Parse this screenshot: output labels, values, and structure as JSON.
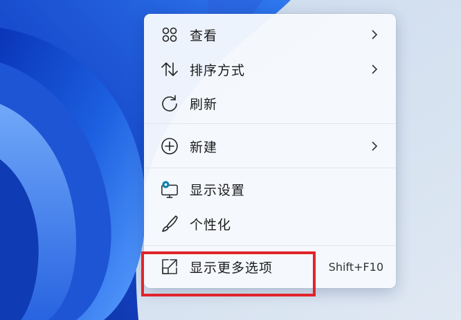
{
  "context_menu": {
    "items": [
      {
        "label": "查看",
        "icon": "grid-view-icon",
        "has_submenu": true
      },
      {
        "label": "排序方式",
        "icon": "sort-arrows-icon",
        "has_submenu": true
      },
      {
        "label": "刷新",
        "icon": "refresh-icon",
        "has_submenu": false
      },
      {
        "label": "新建",
        "icon": "plus-circle-icon",
        "has_submenu": true
      },
      {
        "label": "显示设置",
        "icon": "display-settings-icon",
        "has_submenu": false
      },
      {
        "label": "个性化",
        "icon": "brush-icon",
        "has_submenu": false
      },
      {
        "label": "显示更多选项",
        "icon": "open-external-icon",
        "has_submenu": false,
        "shortcut": "Shift+F10"
      }
    ]
  },
  "annotation": {
    "highlight_color": "#e0242b",
    "highlighted_item": "显示更多选项"
  },
  "colors": {
    "menu_background": "#f6f9fd",
    "wallpaper_primary": "#1a56d6",
    "wallpaper_background": "#d7e3ef",
    "display_icon_accent": "#0f7fa8"
  }
}
